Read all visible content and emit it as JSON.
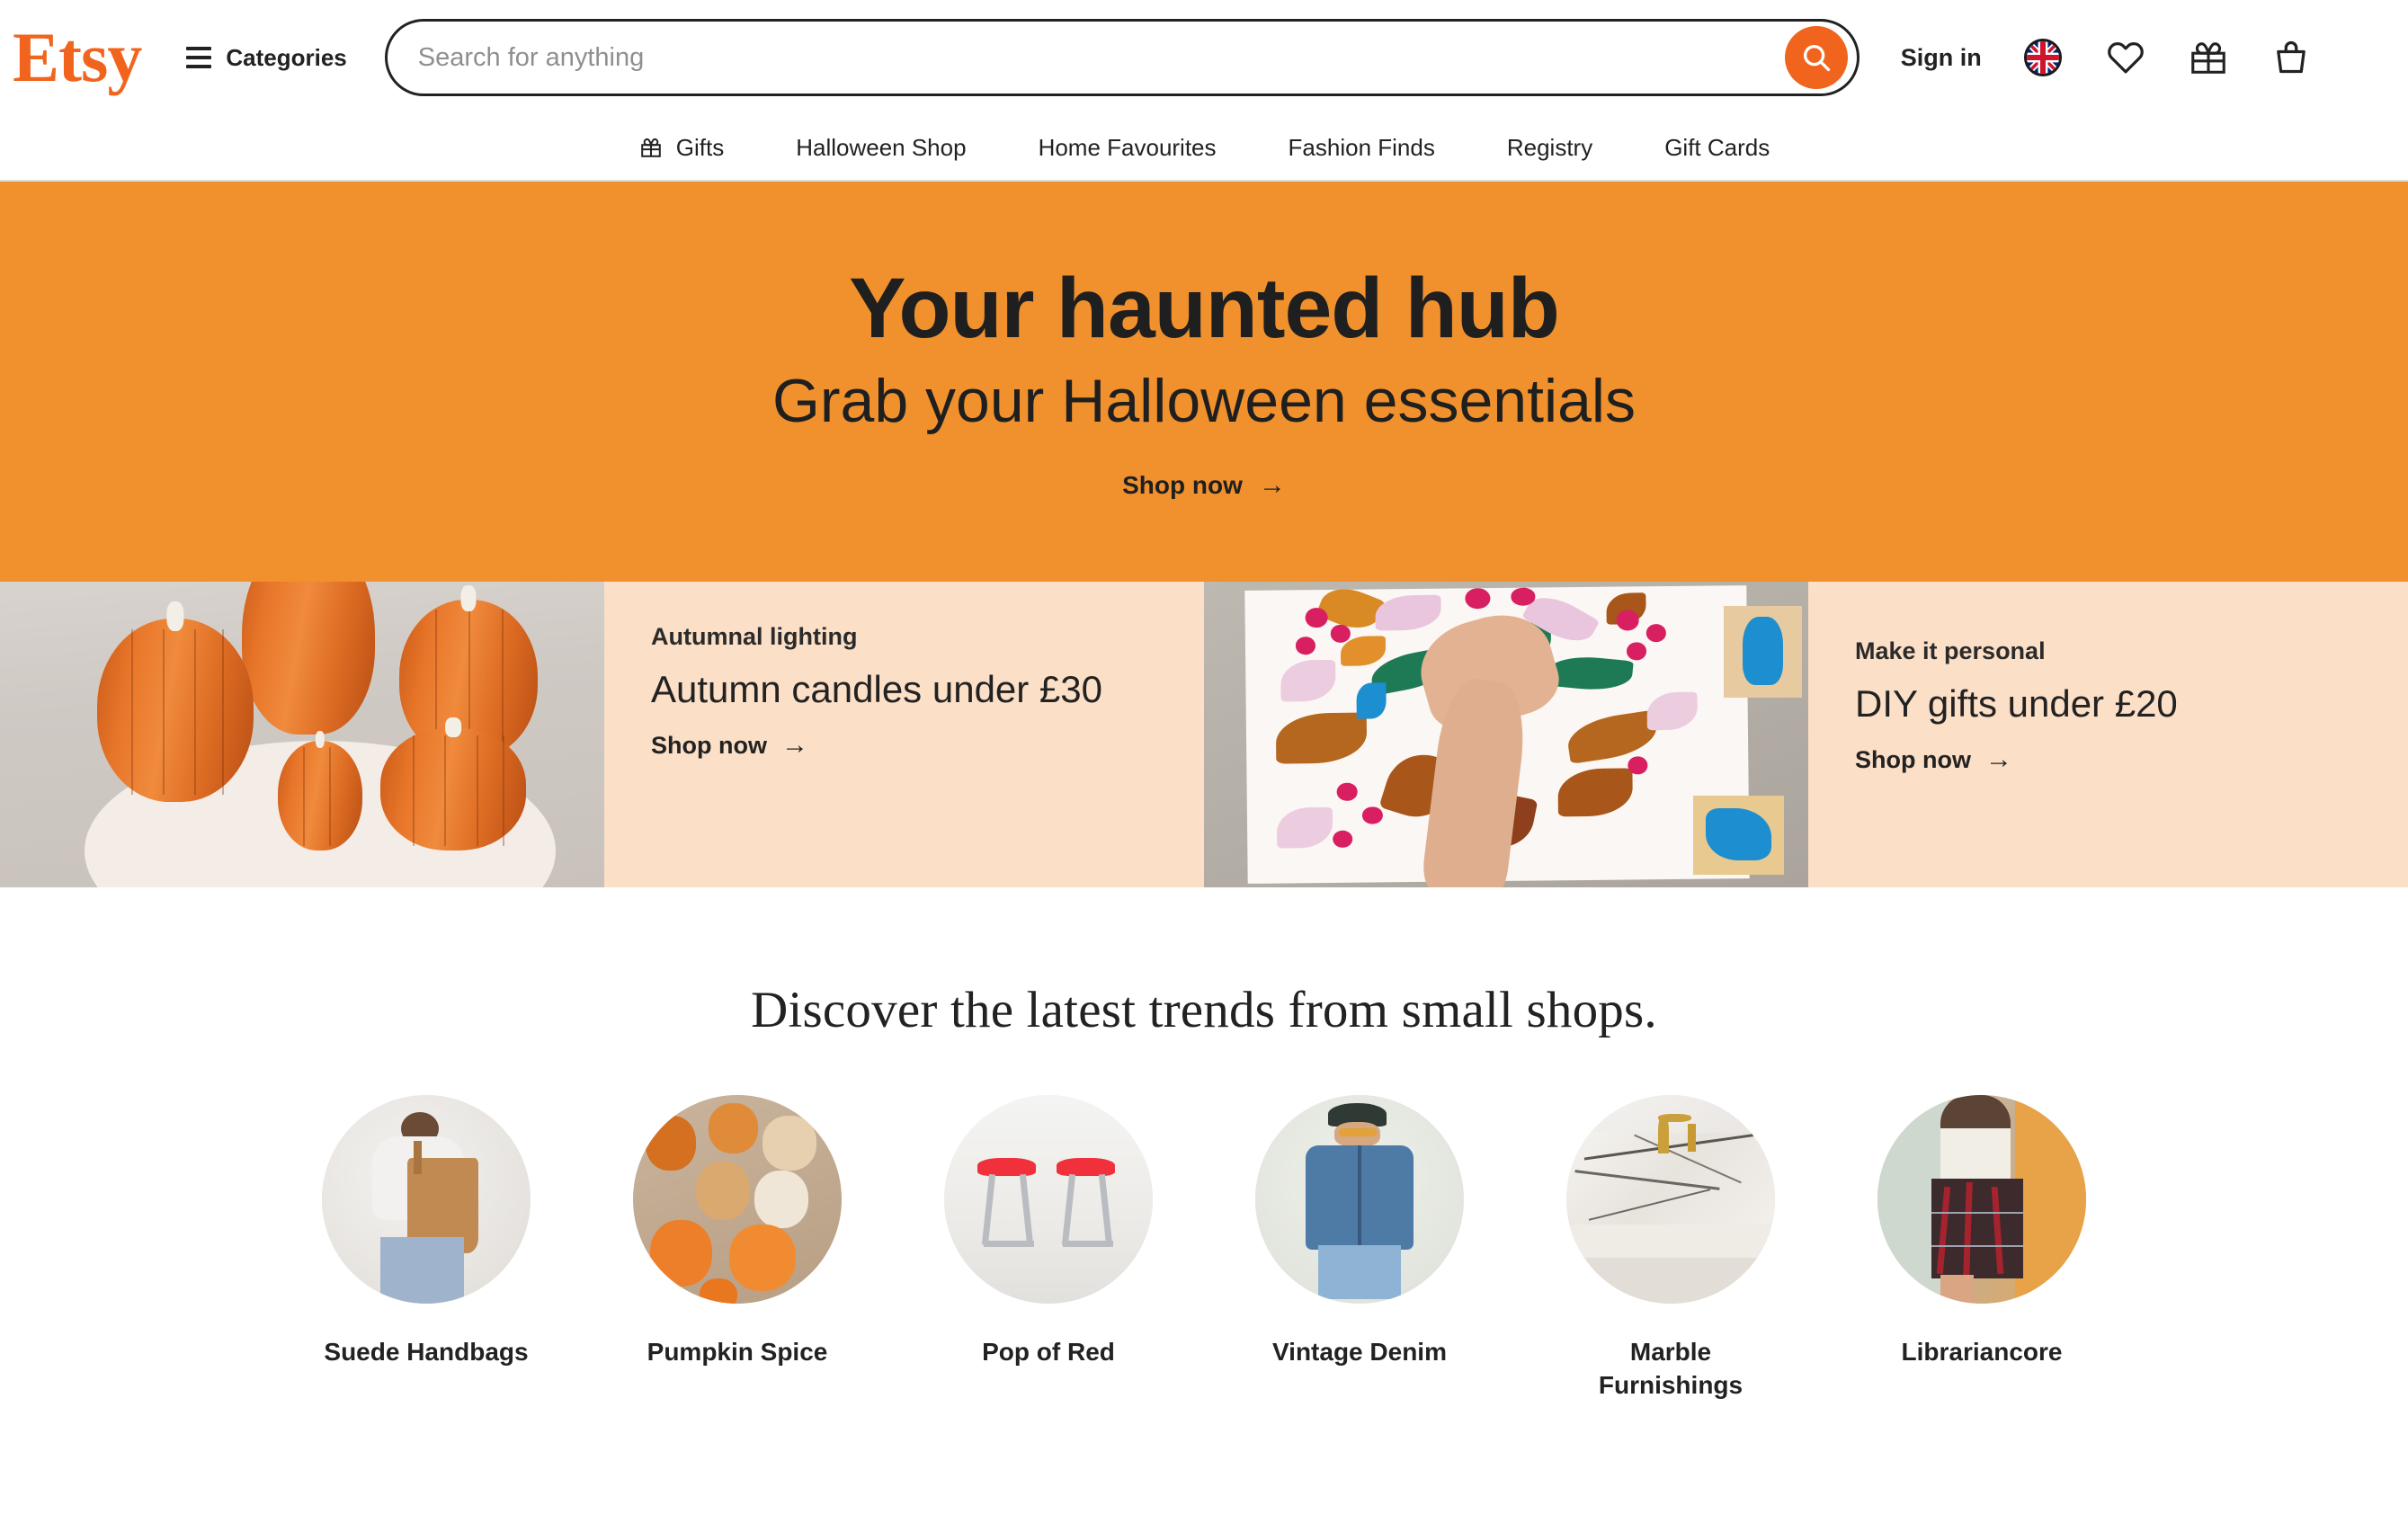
{
  "brand": {
    "name": "Etsy",
    "logo_color": "#F1641E"
  },
  "header": {
    "categories_label": "Categories",
    "search": {
      "placeholder": "Search for anything",
      "value": "",
      "button_icon": "search-icon"
    },
    "sign_in_label": "Sign in",
    "icons": [
      {
        "name": "uk-flag-icon",
        "label": "United Kingdom"
      },
      {
        "name": "heart-icon",
        "label": "Favourites"
      },
      {
        "name": "gift-icon",
        "label": "Gift Mode"
      },
      {
        "name": "cart-icon",
        "label": "Cart"
      }
    ]
  },
  "nav": {
    "items": [
      {
        "label": "Gifts",
        "icon": "gift-icon"
      },
      {
        "label": "Halloween Shop",
        "icon": ""
      },
      {
        "label": "Home Favourites",
        "icon": ""
      },
      {
        "label": "Fashion Finds",
        "icon": ""
      },
      {
        "label": "Registry",
        "icon": ""
      },
      {
        "label": "Gift Cards",
        "icon": ""
      }
    ]
  },
  "hero": {
    "title": "Your haunted hub",
    "subtitle": "Grab your Halloween essentials",
    "cta": "Shop now",
    "arrow": "→",
    "background_color": "#F0912D"
  },
  "promos": [
    {
      "image_alt": "orange pumpkin-shaped candles on a white plate",
      "eyebrow": "Autumnal lighting",
      "title": "Autumn candles under £30",
      "cta": "Shop now",
      "arrow": "→",
      "background_color": "#FBDFC6"
    },
    {
      "image_alt": "hands block-printing a floral pattern on white fabric",
      "eyebrow": "Make it personal",
      "title": "DIY gifts under £20",
      "cta": "Shop now",
      "arrow": "→",
      "background_color": "#FBDFC6"
    }
  ],
  "trends": {
    "heading": "Discover the latest trends from small shops.",
    "items": [
      {
        "label": "Suede Handbags",
        "image_alt": "person carrying a tan suede tote bag"
      },
      {
        "label": "Pumpkin Spice",
        "image_alt": "assorted pumpkin candles in cream and orange"
      },
      {
        "label": "Pop of Red",
        "image_alt": "two red bar stools with chrome legs"
      },
      {
        "label": "Vintage Denim",
        "image_alt": "man in a blue denim shirt and cap"
      },
      {
        "label": "Marble Furnishings",
        "image_alt": "marble bathroom vanity with gold tap"
      },
      {
        "label": "Librariancore",
        "image_alt": "person in a red tartan pleated skirt"
      }
    ]
  }
}
